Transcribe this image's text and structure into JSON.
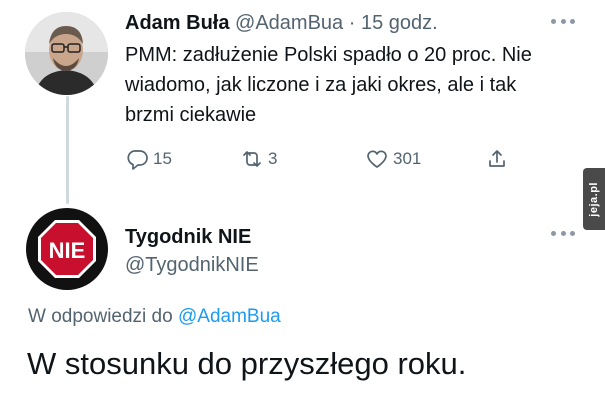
{
  "tweet1": {
    "author_name": "Adam Buła",
    "author_handle": "@AdamBua",
    "separator": "·",
    "time": "15 godz.",
    "text": "PMM: zadłużenie Polski spadło o 20 proc. Nie wiadomo, jak liczone i za jaki okres, ale i tak brzmi ciekawie",
    "reply_count": "15",
    "retweet_count": "3",
    "like_count": "301"
  },
  "side_badge": {
    "text": "jeja.pl"
  },
  "tweet2": {
    "author_name": "Tygodnik NIE",
    "author_handle": "@TygodnikNIE",
    "avatar_text": "NIE",
    "reply_prefix": "W odpowiedzi do",
    "reply_mention": "@AdamBua",
    "text": "W stosunku do przyszłego roku."
  },
  "colors": {
    "text_primary": "#0f1419",
    "text_secondary": "#536471",
    "link": "#1d9bf0",
    "thread_line": "#cfd9de",
    "stop_sign_red": "#c8102e"
  },
  "icons": [
    "reply-icon",
    "retweet-icon",
    "like-icon",
    "share-icon",
    "more-options-icon"
  ]
}
